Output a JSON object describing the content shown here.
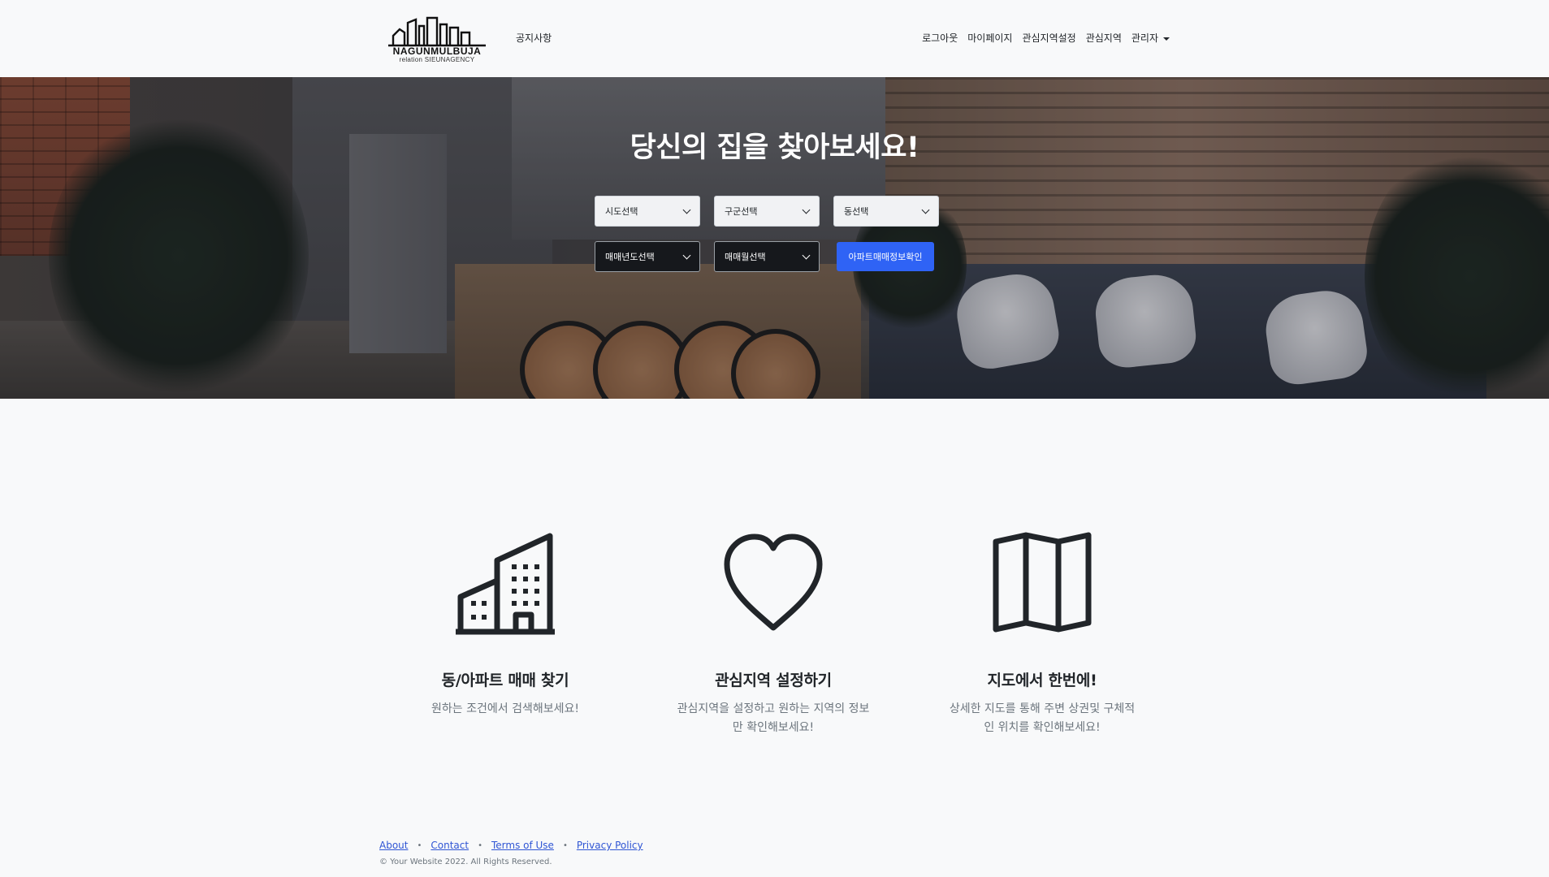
{
  "nav": {
    "logo_name": "NAGUNMULBUJA",
    "logo_sub": "relation SIEUNAGENCY",
    "notice": "공지사항",
    "logout": "로그아웃",
    "mypage": "마이페이지",
    "interest_setting": "관심지역설정",
    "interest": "관심지역",
    "admin": "관리자"
  },
  "hero": {
    "title": "당신의 집을 찾아보세요!",
    "sido": "시도선택",
    "gugun": "구군선택",
    "dong": "동선택",
    "year": "매매년도선택",
    "month": "매매월선택",
    "search_button": "아파트매매정보확인"
  },
  "features": [
    {
      "icon": "building-icon",
      "title": "동/아파트 매매 찾기",
      "desc": "원하는 조건에서 검색해보세요!"
    },
    {
      "icon": "heart-icon",
      "title": "관심지역 설정하기",
      "desc": "관심지역을 설정하고 원하는 지역의 정보만 확인해보세요!"
    },
    {
      "icon": "map-icon",
      "title": "지도에서 한번에!",
      "desc": "상세한 지도를 통해 주변 상권및 구체적인 위치를 확인해보세요!"
    }
  ],
  "footer": {
    "about": "About",
    "contact": "Contact",
    "terms": "Terms of Use",
    "privacy": "Privacy Policy",
    "copyright": "© Your Website 2022. All Rights Reserved."
  },
  "colors": {
    "primary": "#2f63f5",
    "background": "#f8f9fa",
    "text": "#212529",
    "muted": "#6c757d",
    "link": "#2f55d4"
  }
}
